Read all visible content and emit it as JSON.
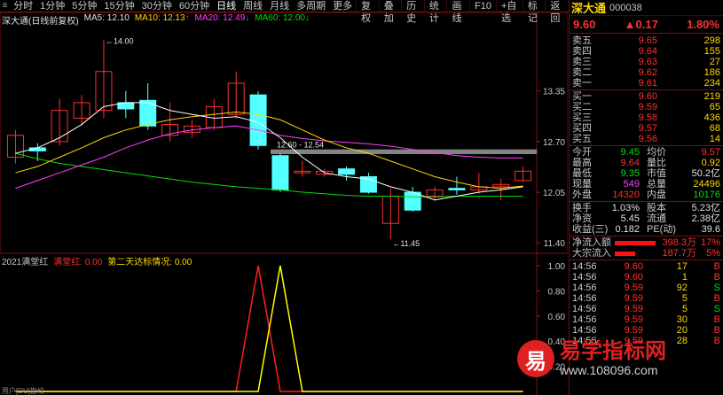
{
  "toolbar": {
    "periods": [
      "分时",
      "1分钟",
      "5分钟",
      "15分钟",
      "30分钟",
      "60分钟",
      "日线",
      "周线",
      "月线",
      "多周期",
      "更多"
    ],
    "active": "日线",
    "tools": [
      "复权",
      "叠加",
      "历史",
      "统计",
      "画线",
      "F10",
      "+自选",
      "标记",
      "返回"
    ]
  },
  "legend": {
    "title": "深大通(日线前复权)",
    "ma5": "MA5: 12.10",
    "ma10": "MA10: 12.13",
    "ma20": "MA20: 12.49",
    "ma60": "MA60: 12.00",
    "ma60_arrow": "↓",
    "ma10_arrow": "↑",
    "ma20_arrow": "↓"
  },
  "indicator": {
    "name": "2021满堂红",
    "series1": "满堂红: 0.00",
    "series2": "第二天达标情况: 0.00",
    "y_labels": [
      "1.00",
      "0.80",
      "0.60",
      "0.40",
      "0.20"
    ]
  },
  "price_axis": [
    "13.35",
    "12.70",
    "12.05",
    "11.40"
  ],
  "annotations": {
    "high": "14.00",
    "low": "11.45",
    "zone": "12.60 - 12.54"
  },
  "colors": {
    "up": "#ff3030",
    "down": "#54ffff",
    "ma5": "#ffffff",
    "ma10": "#ffd700",
    "ma20": "#ff40ff",
    "ma60": "#00e000",
    "ind1": "#ff2020",
    "ind2": "#ffff00"
  },
  "chart_data": {
    "type": "candlestick",
    "candles": [
      {
        "o": 12.5,
        "c": 12.78,
        "h": 12.85,
        "l": 12.42
      },
      {
        "o": 12.62,
        "c": 12.58,
        "h": 12.68,
        "l": 12.45
      },
      {
        "o": 12.7,
        "c": 13.1,
        "h": 13.25,
        "l": 12.65
      },
      {
        "o": 13.0,
        "c": 13.2,
        "h": 13.3,
        "l": 12.9
      },
      {
        "o": 13.1,
        "c": 13.6,
        "h": 14.0,
        "l": 13.0
      },
      {
        "o": 13.2,
        "c": 13.12,
        "h": 13.35,
        "l": 13.0
      },
      {
        "o": 13.23,
        "c": 12.9,
        "h": 13.45,
        "l": 12.85
      },
      {
        "o": 12.78,
        "c": 12.92,
        "h": 13.2,
        "l": 12.7
      },
      {
        "o": 12.82,
        "c": 12.9,
        "h": 12.98,
        "l": 12.75
      },
      {
        "o": 12.88,
        "c": 13.15,
        "h": 13.25,
        "l": 12.85
      },
      {
        "o": 13.05,
        "c": 13.45,
        "h": 13.6,
        "l": 13.0
      },
      {
        "o": 13.3,
        "c": 12.65,
        "h": 13.35,
        "l": 12.6
      },
      {
        "o": 12.52,
        "c": 12.08,
        "h": 12.55,
        "l": 12.05
      },
      {
        "o": 12.3,
        "c": 12.32,
        "h": 12.45,
        "l": 12.25
      },
      {
        "o": 12.28,
        "c": 12.32,
        "h": 12.35,
        "l": 12.25
      },
      {
        "o": 12.35,
        "c": 12.28,
        "h": 12.38,
        "l": 12.2
      },
      {
        "o": 12.25,
        "c": 12.05,
        "h": 12.3,
        "l": 12.03
      },
      {
        "o": 11.65,
        "c": 12.0,
        "h": 12.1,
        "l": 11.45
      },
      {
        "o": 12.05,
        "c": 11.82,
        "h": 12.12,
        "l": 11.8
      },
      {
        "o": 12.0,
        "c": 12.08,
        "h": 12.12,
        "l": 11.95
      },
      {
        "o": 12.1,
        "c": 12.08,
        "h": 12.25,
        "l": 12.02
      },
      {
        "o": 12.08,
        "c": 12.12,
        "h": 12.3,
        "l": 12.03
      },
      {
        "o": 12.12,
        "c": 12.15,
        "h": 12.22,
        "l": 11.95
      },
      {
        "o": 12.2,
        "c": 12.32,
        "h": 12.38,
        "l": 12.18
      }
    ],
    "ma5": [
      12.55,
      12.62,
      12.75,
      12.92,
      13.15,
      13.2,
      13.2,
      13.1,
      13.05,
      13.0,
      13.02,
      12.95,
      12.75,
      12.5,
      12.3,
      12.25,
      12.22,
      12.12,
      12.05,
      11.95,
      12.0,
      12.05,
      12.08,
      12.12
    ],
    "ma10": [
      12.3,
      12.38,
      12.5,
      12.62,
      12.75,
      12.85,
      12.92,
      12.98,
      13.02,
      13.05,
      13.08,
      13.05,
      12.98,
      12.85,
      12.72,
      12.62,
      12.55,
      12.45,
      12.35,
      12.25,
      12.18,
      12.12,
      12.1,
      12.13
    ],
    "ma20": [
      12.1,
      12.2,
      12.3,
      12.4,
      12.5,
      12.62,
      12.72,
      12.8,
      12.85,
      12.88,
      12.9,
      12.85,
      12.78,
      12.74,
      12.71,
      12.69,
      12.67,
      12.64,
      12.6,
      12.56,
      12.52,
      12.5,
      12.49,
      12.49
    ],
    "ma60": [
      12.55,
      12.48,
      12.42,
      12.38,
      12.34,
      12.3,
      12.26,
      12.22,
      12.18,
      12.15,
      12.12,
      12.1,
      12.08,
      12.05,
      12.03,
      12.01,
      12.0,
      12.0,
      11.99,
      11.99,
      12.0,
      12.0,
      12.0,
      12.0
    ],
    "signal1_index": 11,
    "signal2_index": 12,
    "ylim": [
      11.3,
      14.2
    ]
  },
  "panel": {
    "name": "深大通",
    "code": "000038",
    "price": "9.60",
    "change": "▲0.17",
    "pct": "1.80%",
    "asks": [
      {
        "label": "卖五",
        "price": "9.65",
        "vol": "298"
      },
      {
        "label": "卖四",
        "price": "9.64",
        "vol": "155"
      },
      {
        "label": "卖三",
        "price": "9.63",
        "vol": "27"
      },
      {
        "label": "卖二",
        "price": "9.62",
        "vol": "186"
      },
      {
        "label": "卖一",
        "price": "9.61",
        "vol": "234"
      }
    ],
    "bids": [
      {
        "label": "买一",
        "price": "9.60",
        "vol": "219"
      },
      {
        "label": "买二",
        "price": "9.59",
        "vol": "65"
      },
      {
        "label": "买三",
        "price": "9.58",
        "vol": "436"
      },
      {
        "label": "买四",
        "price": "9.57",
        "vol": "68"
      },
      {
        "label": "买五",
        "price": "9.56",
        "vol": "14"
      }
    ],
    "stats": [
      {
        "l1": "今开",
        "v1": "9.45",
        "c1": "green",
        "l2": "均价",
        "v2": "9.57",
        "c2": "red"
      },
      {
        "l1": "最高",
        "v1": "9.64",
        "c1": "red",
        "l2": "量比",
        "v2": "0.92",
        "c2": "yellow"
      },
      {
        "l1": "最低",
        "v1": "9.35",
        "c1": "green",
        "l2": "市值",
        "v2": "50.2亿",
        "c2": "white"
      },
      {
        "l1": "现量",
        "v1": "549",
        "c1": "magenta",
        "l2": "总量",
        "v2": "24496",
        "c2": "yellow"
      },
      {
        "l1": "外盘",
        "v1": "14320",
        "c1": "red",
        "l2": "内盘",
        "v2": "10176",
        "c2": "green"
      }
    ],
    "stats2": [
      {
        "l1": "换手",
        "v1": "1.03%",
        "c1": "white",
        "l2": "股本",
        "v2": "5.23亿",
        "c2": "white"
      },
      {
        "l1": "净资",
        "v1": "5.45",
        "c1": "white",
        "l2": "流通",
        "v2": "2.38亿",
        "c2": "white"
      },
      {
        "l1": "收益(三)",
        "v1": "0.182",
        "c1": "white",
        "l2": "PE(动)",
        "v2": "39.6",
        "c2": "white"
      }
    ],
    "flows": [
      {
        "label": "净流入额",
        "value": "398.3万",
        "pct": "17%",
        "bar": 1.0
      },
      {
        "label": "大宗流入",
        "value": "187.7万",
        "pct": "5%",
        "bar": 0.5
      }
    ],
    "ticks": [
      {
        "t": "14:56",
        "p": "9.60",
        "v": "17",
        "d": "B"
      },
      {
        "t": "14:56",
        "p": "9.60",
        "v": "1",
        "d": "B"
      },
      {
        "t": "14:56",
        "p": "9.59",
        "v": "92",
        "d": "S"
      },
      {
        "t": "14:56",
        "p": "9.59",
        "v": "5",
        "d": "B"
      },
      {
        "t": "14:56",
        "p": "9.59",
        "v": "5",
        "d": "S"
      },
      {
        "t": "14:56",
        "p": "9.59",
        "v": "30",
        "d": "B"
      },
      {
        "t": "14:56",
        "p": "9.59",
        "v": "20",
        "d": "B"
      },
      {
        "t": "14:56",
        "p": "9.59",
        "v": "28",
        "d": "B"
      }
    ]
  },
  "watermark": {
    "logo": "易",
    "title": "易学指标网",
    "url": "www.108096.com"
  },
  "bottom_note": "用户[DU]勘校"
}
